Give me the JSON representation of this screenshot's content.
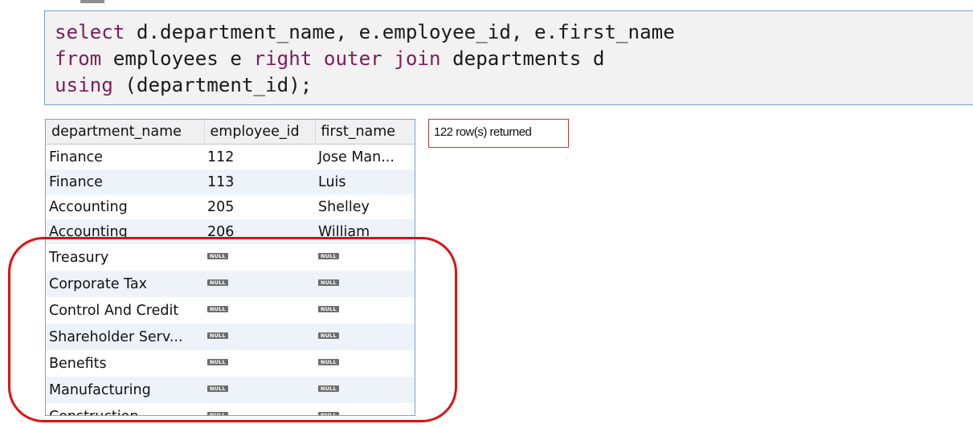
{
  "query": {
    "lines": [
      [
        {
          "t": "select",
          "kw": true
        },
        {
          "t": " d.department_name, e.employee_id, e.first_name",
          "kw": false
        }
      ],
      [
        {
          "t": "from",
          "kw": true
        },
        {
          "t": " employees e ",
          "kw": false
        },
        {
          "t": "right outer join",
          "kw": true
        },
        {
          "t": " departments d",
          "kw": false
        }
      ],
      [
        {
          "t": "using",
          "kw": true
        },
        {
          "t": " (department_id);",
          "kw": false
        }
      ]
    ]
  },
  "result_grid": {
    "columns": [
      "department_name",
      "employee_id",
      "first_name"
    ],
    "null_label": "NULL",
    "rows": [
      [
        "Finance",
        "112",
        "Jose Man..."
      ],
      [
        "Finance",
        "113",
        "Luis"
      ],
      [
        "Accounting",
        "205",
        "Shelley"
      ],
      [
        "Accounting",
        "206",
        "William"
      ],
      [
        "Treasury",
        null,
        null
      ],
      [
        "Corporate Tax",
        null,
        null
      ],
      [
        "Control And Credit",
        null,
        null
      ],
      [
        "Shareholder Serv...",
        null,
        null
      ],
      [
        "Benefits",
        null,
        null
      ],
      [
        "Manufacturing",
        null,
        null
      ],
      [
        "Construction",
        null,
        null
      ]
    ]
  },
  "status": {
    "rows_returned": "122 row(s) returned"
  },
  "colors": {
    "keyword": "#7f1c59",
    "alt_row": "#eef3fa",
    "highlight": "#e01010",
    "status_border": "#c0392b"
  }
}
